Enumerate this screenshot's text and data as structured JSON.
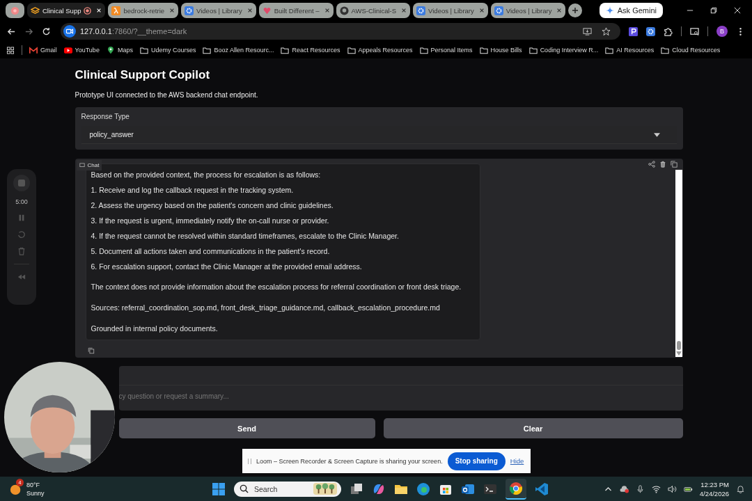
{
  "browser": {
    "tabs": [
      {
        "selected": false,
        "recording": false
      },
      {
        "title": "Clinical Supp",
        "selected": true,
        "recording": true
      },
      {
        "title": "bedrock-retrie",
        "selected": false,
        "recording": false
      },
      {
        "title": "Videos | Library",
        "selected": false,
        "recording": false
      },
      {
        "title": "Built Different –",
        "selected": false,
        "recording": false
      },
      {
        "title": "AWS-Clinical-S",
        "selected": false,
        "recording": false
      },
      {
        "title": "Videos | Library",
        "selected": false,
        "recording": false
      },
      {
        "title": "Videos | Library",
        "selected": false,
        "recording": false
      }
    ],
    "gemini_button": "Ask Gemini",
    "address": {
      "host": "127.0.0.1",
      "rest": ":7860/?__theme=dark"
    },
    "profile_initial": "B",
    "bookmarks": [
      {
        "label": "Gmail"
      },
      {
        "label": "YouTube"
      },
      {
        "label": "Maps"
      },
      {
        "label": "Udemy Courses"
      },
      {
        "label": "Booz Allen Resourc..."
      },
      {
        "label": "React Resources"
      },
      {
        "label": "Appeals Resources"
      },
      {
        "label": "Personal Items"
      },
      {
        "label": "House Bills"
      },
      {
        "label": "Coding Interview R..."
      },
      {
        "label": "AI Resources"
      },
      {
        "label": "Cloud Resources"
      }
    ]
  },
  "page": {
    "title": "Clinical Support Copilot",
    "description": "Prototype UI connected to the AWS backend chat endpoint.",
    "response_type": {
      "label": "Response Type",
      "value": "policy_answer"
    },
    "chat": {
      "label": "Chat",
      "message": [
        {
          "kind": "list_item",
          "text": "Based on the provided context, the process for escalation is as follows:"
        },
        {
          "kind": "list_item",
          "text": "1. Receive and log the callback request in the tracking system."
        },
        {
          "kind": "list_item",
          "text": "2. Assess the urgency based on the patient's concern and clinic guidelines."
        },
        {
          "kind": "list_item",
          "text": "3. If the request is urgent, immediately notify the on-call nurse or provider."
        },
        {
          "kind": "list_item",
          "text": "4. If the request cannot be resolved within standard timeframes, escalate to the Clinic Manager."
        },
        {
          "kind": "list_item",
          "text": "5. Document all actions taken and communications in the patient's record."
        },
        {
          "kind": "list_item",
          "text": "6. For escalation support, contact the Clinic Manager at the provided email address."
        },
        {
          "kind": "paragraph",
          "text": "The context does not provide information about the escalation process for referral coordination or front desk triage."
        },
        {
          "kind": "paragraph",
          "text": "Sources: referral_coordination_sop.md, front_desk_triage_guidance.md, callback_escalation_procedure.md"
        },
        {
          "kind": "paragraph",
          "text": "Grounded in internal policy documents."
        }
      ]
    },
    "input": {
      "placeholder": "cy question or request a summary..."
    },
    "buttons": [
      "Send",
      "Clear"
    ]
  },
  "loom": {
    "timer": "5:00",
    "notice": "Loom – Screen Recorder & Screen Capture is sharing your screen.",
    "stop_button": "Stop sharing",
    "hide_link": "Hide"
  },
  "taskbar": {
    "weather": {
      "badge": "4",
      "temperature": "80°F",
      "condition": "Sunny"
    },
    "search": "Search",
    "time": "12:23 PM",
    "date": "4/24/2026"
  }
}
